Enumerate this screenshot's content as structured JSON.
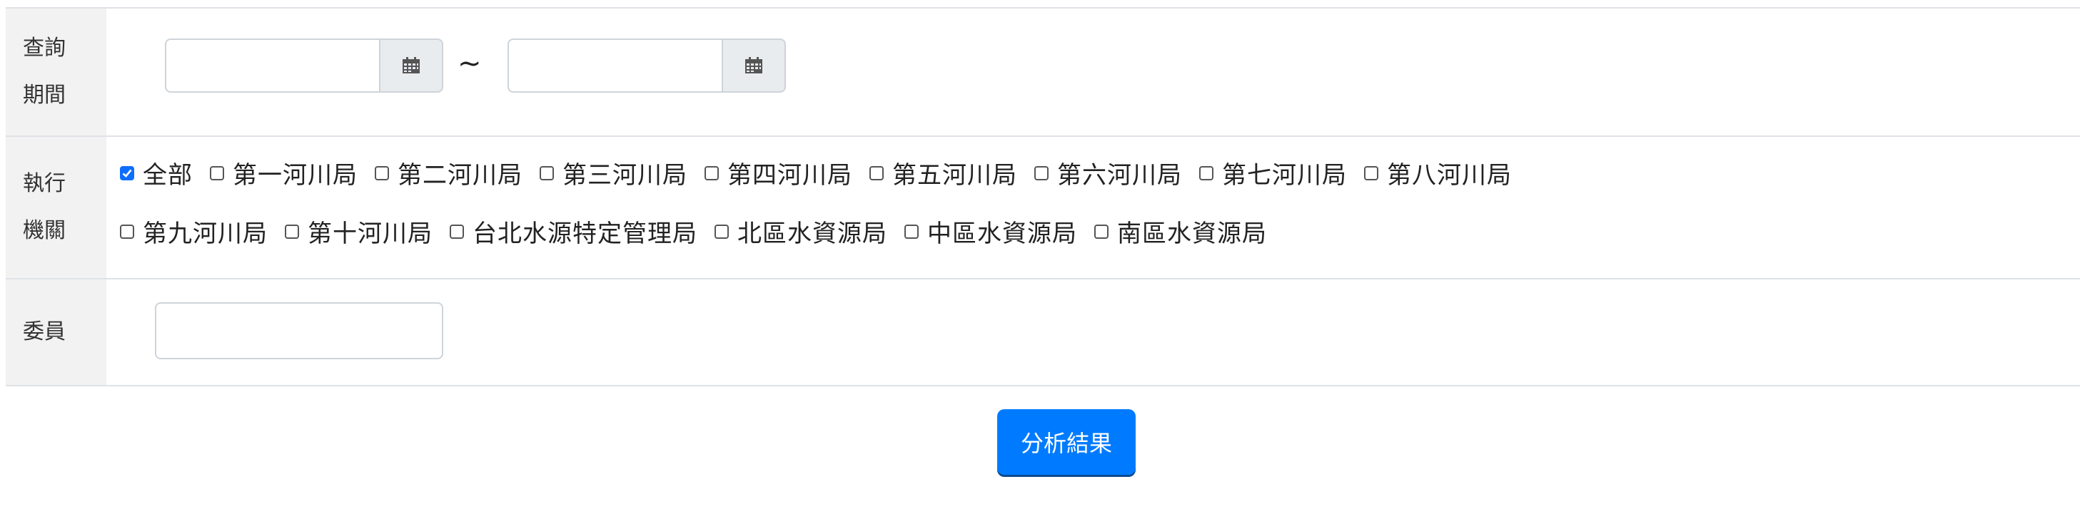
{
  "period": {
    "label_line1": "查詢",
    "label_line2": "期間",
    "start_value": "",
    "end_value": "",
    "separator": "~",
    "calendar_icon": "calendar-icon"
  },
  "agency": {
    "label_line1": "執行",
    "label_line2": "機關",
    "options": [
      {
        "label": "全部",
        "checked": true
      },
      {
        "label": "第一河川局",
        "checked": false
      },
      {
        "label": "第二河川局",
        "checked": false
      },
      {
        "label": "第三河川局",
        "checked": false
      },
      {
        "label": "第四河川局",
        "checked": false
      },
      {
        "label": "第五河川局",
        "checked": false
      },
      {
        "label": "第六河川局",
        "checked": false
      },
      {
        "label": "第七河川局",
        "checked": false
      },
      {
        "label": "第八河川局",
        "checked": false
      },
      {
        "label": "第九河川局",
        "checked": false
      },
      {
        "label": "第十河川局",
        "checked": false
      },
      {
        "label": "台北水源特定管理局",
        "checked": false
      },
      {
        "label": "北區水資源局",
        "checked": false
      },
      {
        "label": "中區水資源局",
        "checked": false
      },
      {
        "label": "南區水資源局",
        "checked": false
      }
    ]
  },
  "member": {
    "label": "委員",
    "value": ""
  },
  "submit_label": "分析結果",
  "colors": {
    "accent": "#007bff",
    "label_bg": "#f2f2f2",
    "border": "#dee2e6"
  }
}
